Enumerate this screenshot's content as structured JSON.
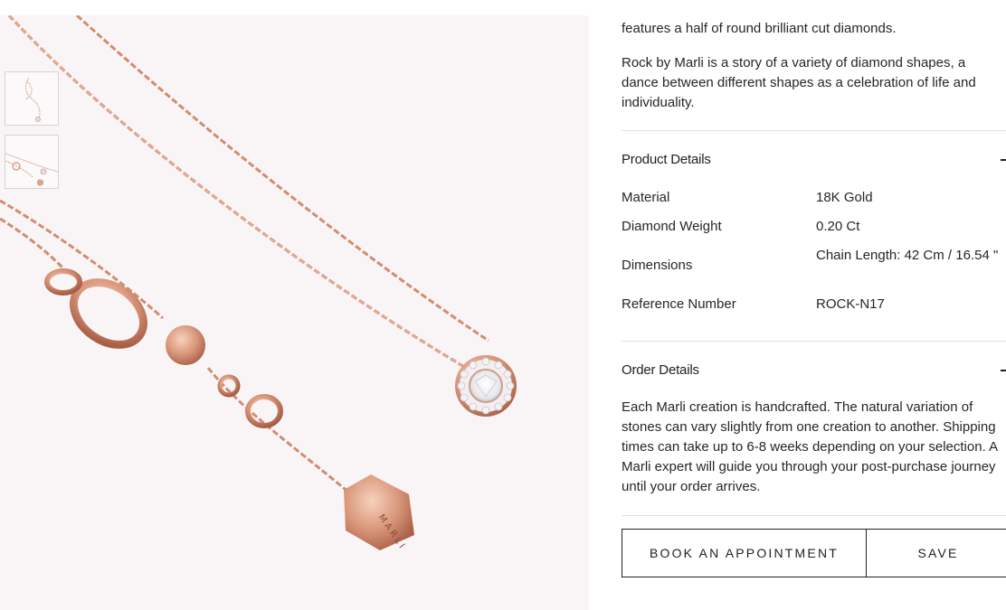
{
  "product": {
    "description_tail": "features a half of round brilliant cut diamonds.",
    "description": "Rock by Marli is a story of a variety of diamond shapes, a dance between different shapes as a celebration of life and individuality."
  },
  "gallery": {
    "tag_text": "MARLI",
    "thumbnails": [
      "necklace-thumbnail-1",
      "necklace-thumbnail-2"
    ]
  },
  "product_details": {
    "title": "Product Details",
    "rows": [
      {
        "label": "Material",
        "value": "18K Gold"
      },
      {
        "label": "Diamond Weight",
        "value": "0.20 Ct"
      },
      {
        "label": "Dimensions",
        "value": "Chain Length: 42 Cm / 16.54 \""
      },
      {
        "label": "Reference Number",
        "value": "ROCK-N17"
      }
    ]
  },
  "order_details": {
    "title": "Order Details",
    "text": "Each Marli creation is handcrafted. The natural variation of stones can vary slightly from one creation to another. Shipping times can take up to 6-8 weeks depending on your selection. A Marli expert will guide you through your post-purchase journey until your order arrives."
  },
  "actions": {
    "appointment_label": "BOOK AN APPOINTMENT",
    "save_label": "SAVE"
  },
  "colors": {
    "rose_gold": "#d9967a",
    "gallery_bg": "#f9f5f6",
    "text": "#1f1f1f"
  }
}
